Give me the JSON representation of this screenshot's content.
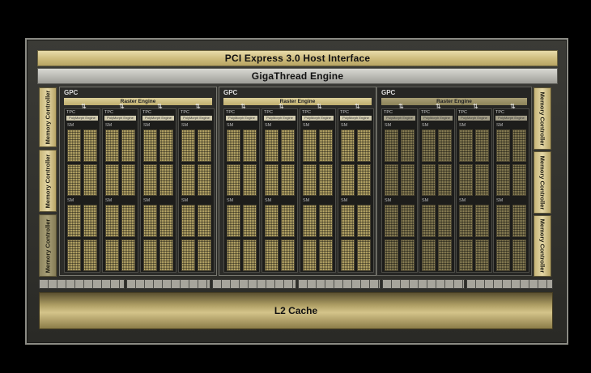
{
  "pci_interface": "PCI Express 3.0 Host Interface",
  "gigathread_engine": "GigaThread Engine",
  "memory_controllers": {
    "label": "Memory Controller",
    "left": [
      "Memory Controller",
      "Memory Controller",
      "Memory Controller"
    ],
    "right": [
      "Memory Controller",
      "Memory Controller",
      "Memory Controller"
    ]
  },
  "gpcs": [
    {
      "label": "GPC",
      "raster": "Raster Engine",
      "tpcs": [
        {
          "label": "TPC",
          "polymorph": "PolyMorph Engine",
          "sms": [
            "SM",
            "SM"
          ]
        },
        {
          "label": "TPC",
          "polymorph": "PolyMorph Engine",
          "sms": [
            "SM",
            "SM"
          ]
        },
        {
          "label": "TPC",
          "polymorph": "PolyMorph Engine",
          "sms": [
            "SM",
            "SM"
          ]
        },
        {
          "label": "TPC",
          "polymorph": "PolyMorph Engine",
          "sms": [
            "SM",
            "SM"
          ]
        }
      ]
    },
    {
      "label": "GPC",
      "raster": "Raster Engine",
      "tpcs": [
        {
          "label": "TPC",
          "polymorph": "PolyMorph Engine",
          "sms": [
            "SM",
            "SM"
          ]
        },
        {
          "label": "TPC",
          "polymorph": "PolyMorph Engine",
          "sms": [
            "SM",
            "SM"
          ]
        },
        {
          "label": "TPC",
          "polymorph": "PolyMorph Engine",
          "sms": [
            "SM",
            "SM"
          ]
        },
        {
          "label": "TPC",
          "polymorph": "PolyMorph Engine",
          "sms": [
            "SM",
            "SM"
          ]
        }
      ]
    },
    {
      "label": "GPC",
      "raster": "Raster Engine",
      "tpcs": [
        {
          "label": "TPC",
          "polymorph": "PolyMorph Engine",
          "sms": [
            "SM",
            "SM"
          ]
        },
        {
          "label": "TPC",
          "polymorph": "PolyMorph Engine",
          "sms": [
            "SM",
            "SM"
          ]
        },
        {
          "label": "TPC",
          "polymorph": "PolyMorph Engine",
          "sms": [
            "SM",
            "SM"
          ]
        },
        {
          "label": "TPC",
          "polymorph": "PolyMorph Engine",
          "sms": [
            "SM",
            "SM"
          ]
        }
      ]
    }
  ],
  "l2_cache": "L2 Cache",
  "colors": {
    "gold": "#d4c48a",
    "silver": "#b6b6b0",
    "background": "#000000",
    "die": "#2c2c29"
  }
}
